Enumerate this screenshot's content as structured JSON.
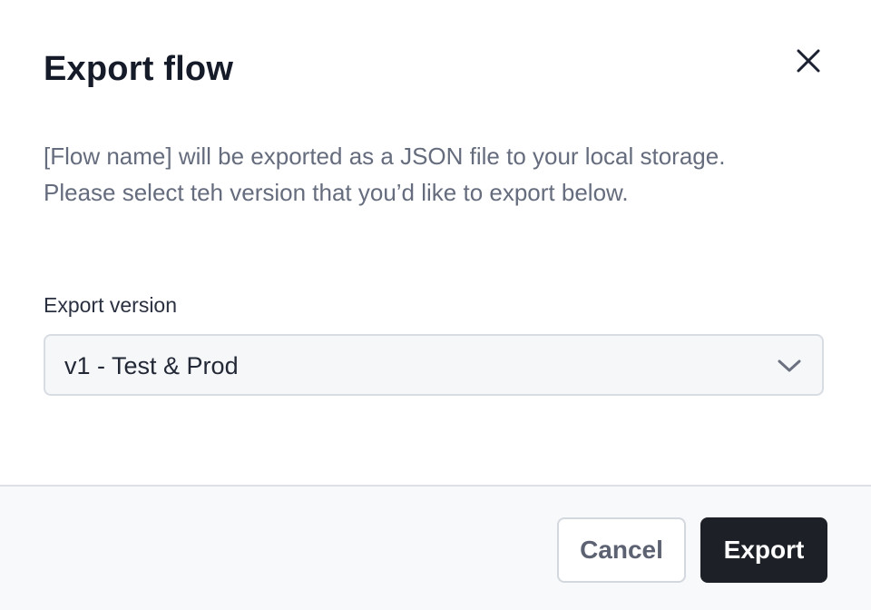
{
  "dialog": {
    "title": "Export flow",
    "description": "[Flow name] will be exported as a JSON file to your local storage. Please select teh version that you’d like to export below.",
    "close_icon": "close-icon"
  },
  "version_field": {
    "label": "Export version",
    "selected": "v1 - Test & Prod",
    "dropdown_icon": "chevron-down-icon"
  },
  "footer": {
    "cancel_label": "Cancel",
    "export_label": "Export"
  },
  "colors": {
    "primary_button": "#1d2027",
    "footer_bg": "#f8f9fb",
    "select_bg": "#f6f7f9"
  }
}
